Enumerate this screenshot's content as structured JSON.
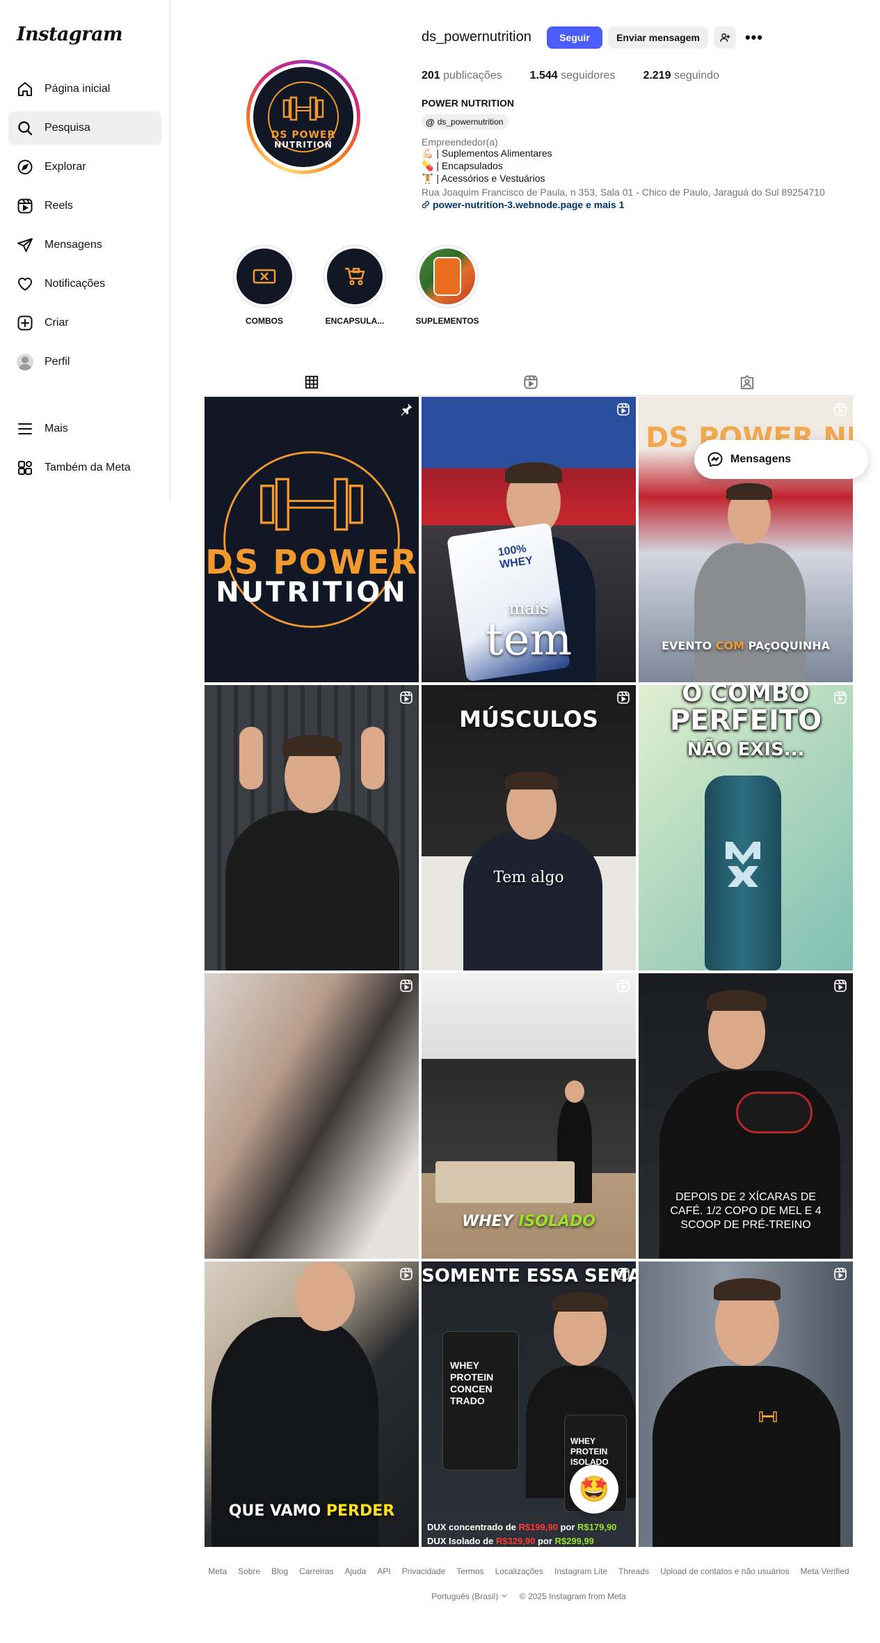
{
  "app": {
    "logo_text": "Instagram"
  },
  "sidebar": {
    "items": [
      {
        "label": "Página inicial",
        "icon": "home-icon"
      },
      {
        "label": "Pesquisa",
        "icon": "search-icon",
        "active": true
      },
      {
        "label": "Explorar",
        "icon": "compass-icon"
      },
      {
        "label": "Reels",
        "icon": "reels-icon"
      },
      {
        "label": "Mensagens",
        "icon": "direct-icon"
      },
      {
        "label": "Notificações",
        "icon": "heart-icon"
      },
      {
        "label": "Criar",
        "icon": "plus-square-icon"
      },
      {
        "label": "Perfil",
        "icon": "avatar"
      }
    ],
    "more_label": "Mais",
    "meta_label": "Também da Meta"
  },
  "profile": {
    "username": "ds_powernutrition",
    "follow_label": "Seguir",
    "message_label": "Enviar mensagem",
    "more_icon": "•••",
    "stats": {
      "posts_value": "201",
      "posts_label": "publicações",
      "followers_value": "1.544",
      "followers_label": "seguidores",
      "following_value": "2.219",
      "following_label": "seguindo"
    },
    "full_name": "POWER NUTRITION",
    "threads_handle": "ds_powernutrition",
    "category": "Empreendedor(a)",
    "bio": [
      "💪🏻 | Suplementos Alimentares",
      "💊 | Encapsulados",
      "🏋️ | Acessórios e Vestuários"
    ],
    "address": "Rua Joaquim Francisco de Paula, n 353, Sala 01 - Chico de Paulo, Jaraguá do Sul 89254710",
    "link": "power-nutrition-3.webnode.page e mais 1",
    "logo_line1": "DS POWER",
    "logo_line2": "NUTRITION"
  },
  "highlights": [
    {
      "label": "COMBOS"
    },
    {
      "label": "ENCAPSULA..."
    },
    {
      "label": "SUPLEMENTOS"
    }
  ],
  "posts": {
    "p1": {
      "line1": "DS POWER",
      "line2": "NUTRITION"
    },
    "p2": {
      "small": "mais",
      "big": "tem",
      "bag_text": "100% WHEY"
    },
    "p3": {
      "cap_a": "EVENTO ",
      "cap_b": "COM",
      "cap_c": " PAçOQUINHA",
      "bg_text": "DS POWER NU"
    },
    "p5": {
      "top": "MÚSCULOS",
      "mid": "Tem algo"
    },
    "p6": {
      "top1": "O COMBO",
      "top2": "PERFEITO",
      "top3": "NÃO EXIS..."
    },
    "p8": {
      "cap_a": "WHEY ",
      "cap_b": "ISOLADO"
    },
    "p9": {
      "cap": "DEPOIS DE 2 XÍCARAS DE CAFÉ. 1/2 COPO DE MEL E 4 SCOOP DE PRÉ-TREINO"
    },
    "p10": {
      "cap_a": "QUE VAMO ",
      "cap_b": "PERDER"
    },
    "p11": {
      "top": "SOMENTE ESSA SEMA...",
      "tub1": "WHEY PROTEIN CONCEN TRADO",
      "tub2": "WHEY PROTEIN ISOLADO",
      "line1_a": "DUX concentrado de ",
      "line1_b": "R$199,90",
      "line1_c": " por ",
      "line1_d": "R$179,90",
      "line2_a": "DUX Isolado de ",
      "line2_b": "R$329,90",
      "line2_c": " por ",
      "line2_d": "R$299,99"
    }
  },
  "floating": {
    "messages_label": "Mensagens",
    "emoji": "🤩"
  },
  "footer": {
    "links": [
      "Meta",
      "Sobre",
      "Blog",
      "Carreiras",
      "Ajuda",
      "API",
      "Privacidade",
      "Termos",
      "Localizações",
      "Instagram Lite",
      "Threads",
      "Upload de contatos e não usuários",
      "Meta Verified"
    ],
    "language": "Português (Brasil)",
    "copyright": "© 2025 Instagram from Meta"
  },
  "colors": {
    "follow_button": "#4a5df9",
    "link": "#00376b",
    "brand_orange": "#f29a2e"
  }
}
